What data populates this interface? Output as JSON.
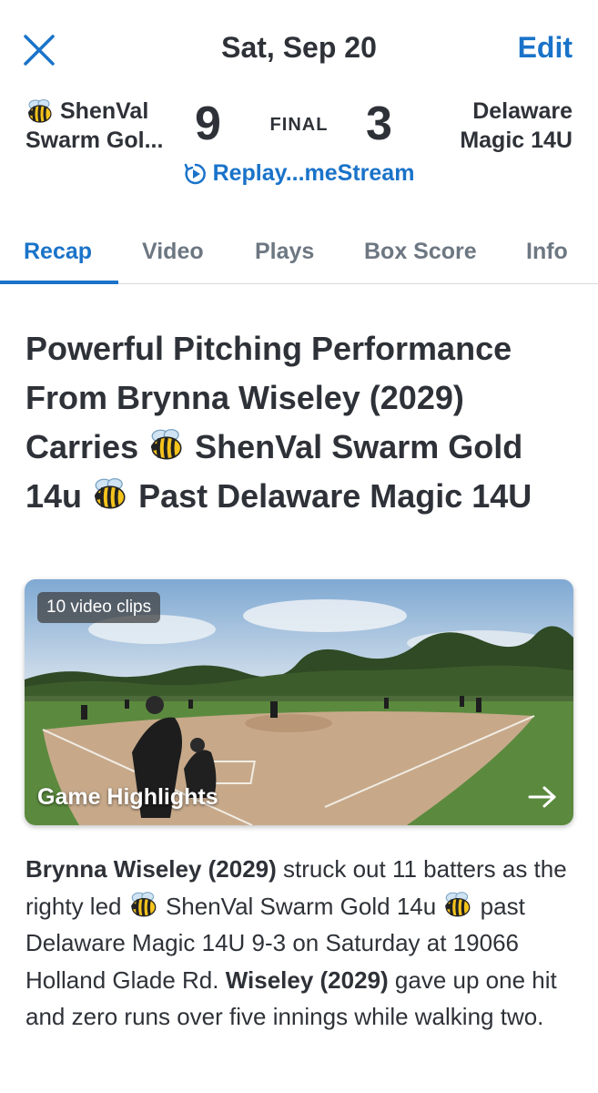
{
  "header": {
    "close_icon": "close-icon",
    "date": "Sat, Sep 20",
    "edit_label": "Edit"
  },
  "game": {
    "home_team_line1": "ShenVal",
    "home_team_line2": "Swarm Gol...",
    "home_score": "9",
    "status": "FINAL",
    "away_score": "3",
    "away_team_line1": "Delaware",
    "away_team_line2": "Magic 14U",
    "replay_label": "Replay...meStream",
    "team_icon": "bee-icon"
  },
  "tabs": [
    {
      "label": "Recap",
      "active": true
    },
    {
      "label": "Video",
      "active": false
    },
    {
      "label": "Plays",
      "active": false
    },
    {
      "label": "Box Score",
      "active": false
    },
    {
      "label": "Info",
      "active": false
    }
  ],
  "recap": {
    "headline_part1": "Powerful Pitching Performance From Brynna Wiseley (2029) Carries",
    "headline_part2": "ShenVal Swarm Gold 14u",
    "headline_part3": "Past Delaware Magic 14U",
    "video": {
      "badge": "10 video clips",
      "title": "Game Highlights",
      "arrow_icon": "arrow-right-icon"
    },
    "summary": {
      "s1_bold": "Brynna Wiseley (2029)",
      "s1_text": " struck out 11 batters as the righty led ",
      "s1_team": " ShenVal Swarm Gold 14u ",
      "s1_rest": " past Delaware Magic 14U 9-3 on Saturday at 19066 Holland Glade Rd.",
      "s2_bold": "Wiseley (2029)",
      "s2_text": " gave up one hit and zero runs over five innings while walking two."
    }
  },
  "colors": {
    "accent": "#1a73c9",
    "text": "#2e3238",
    "muted_tab": "#6d7782"
  }
}
